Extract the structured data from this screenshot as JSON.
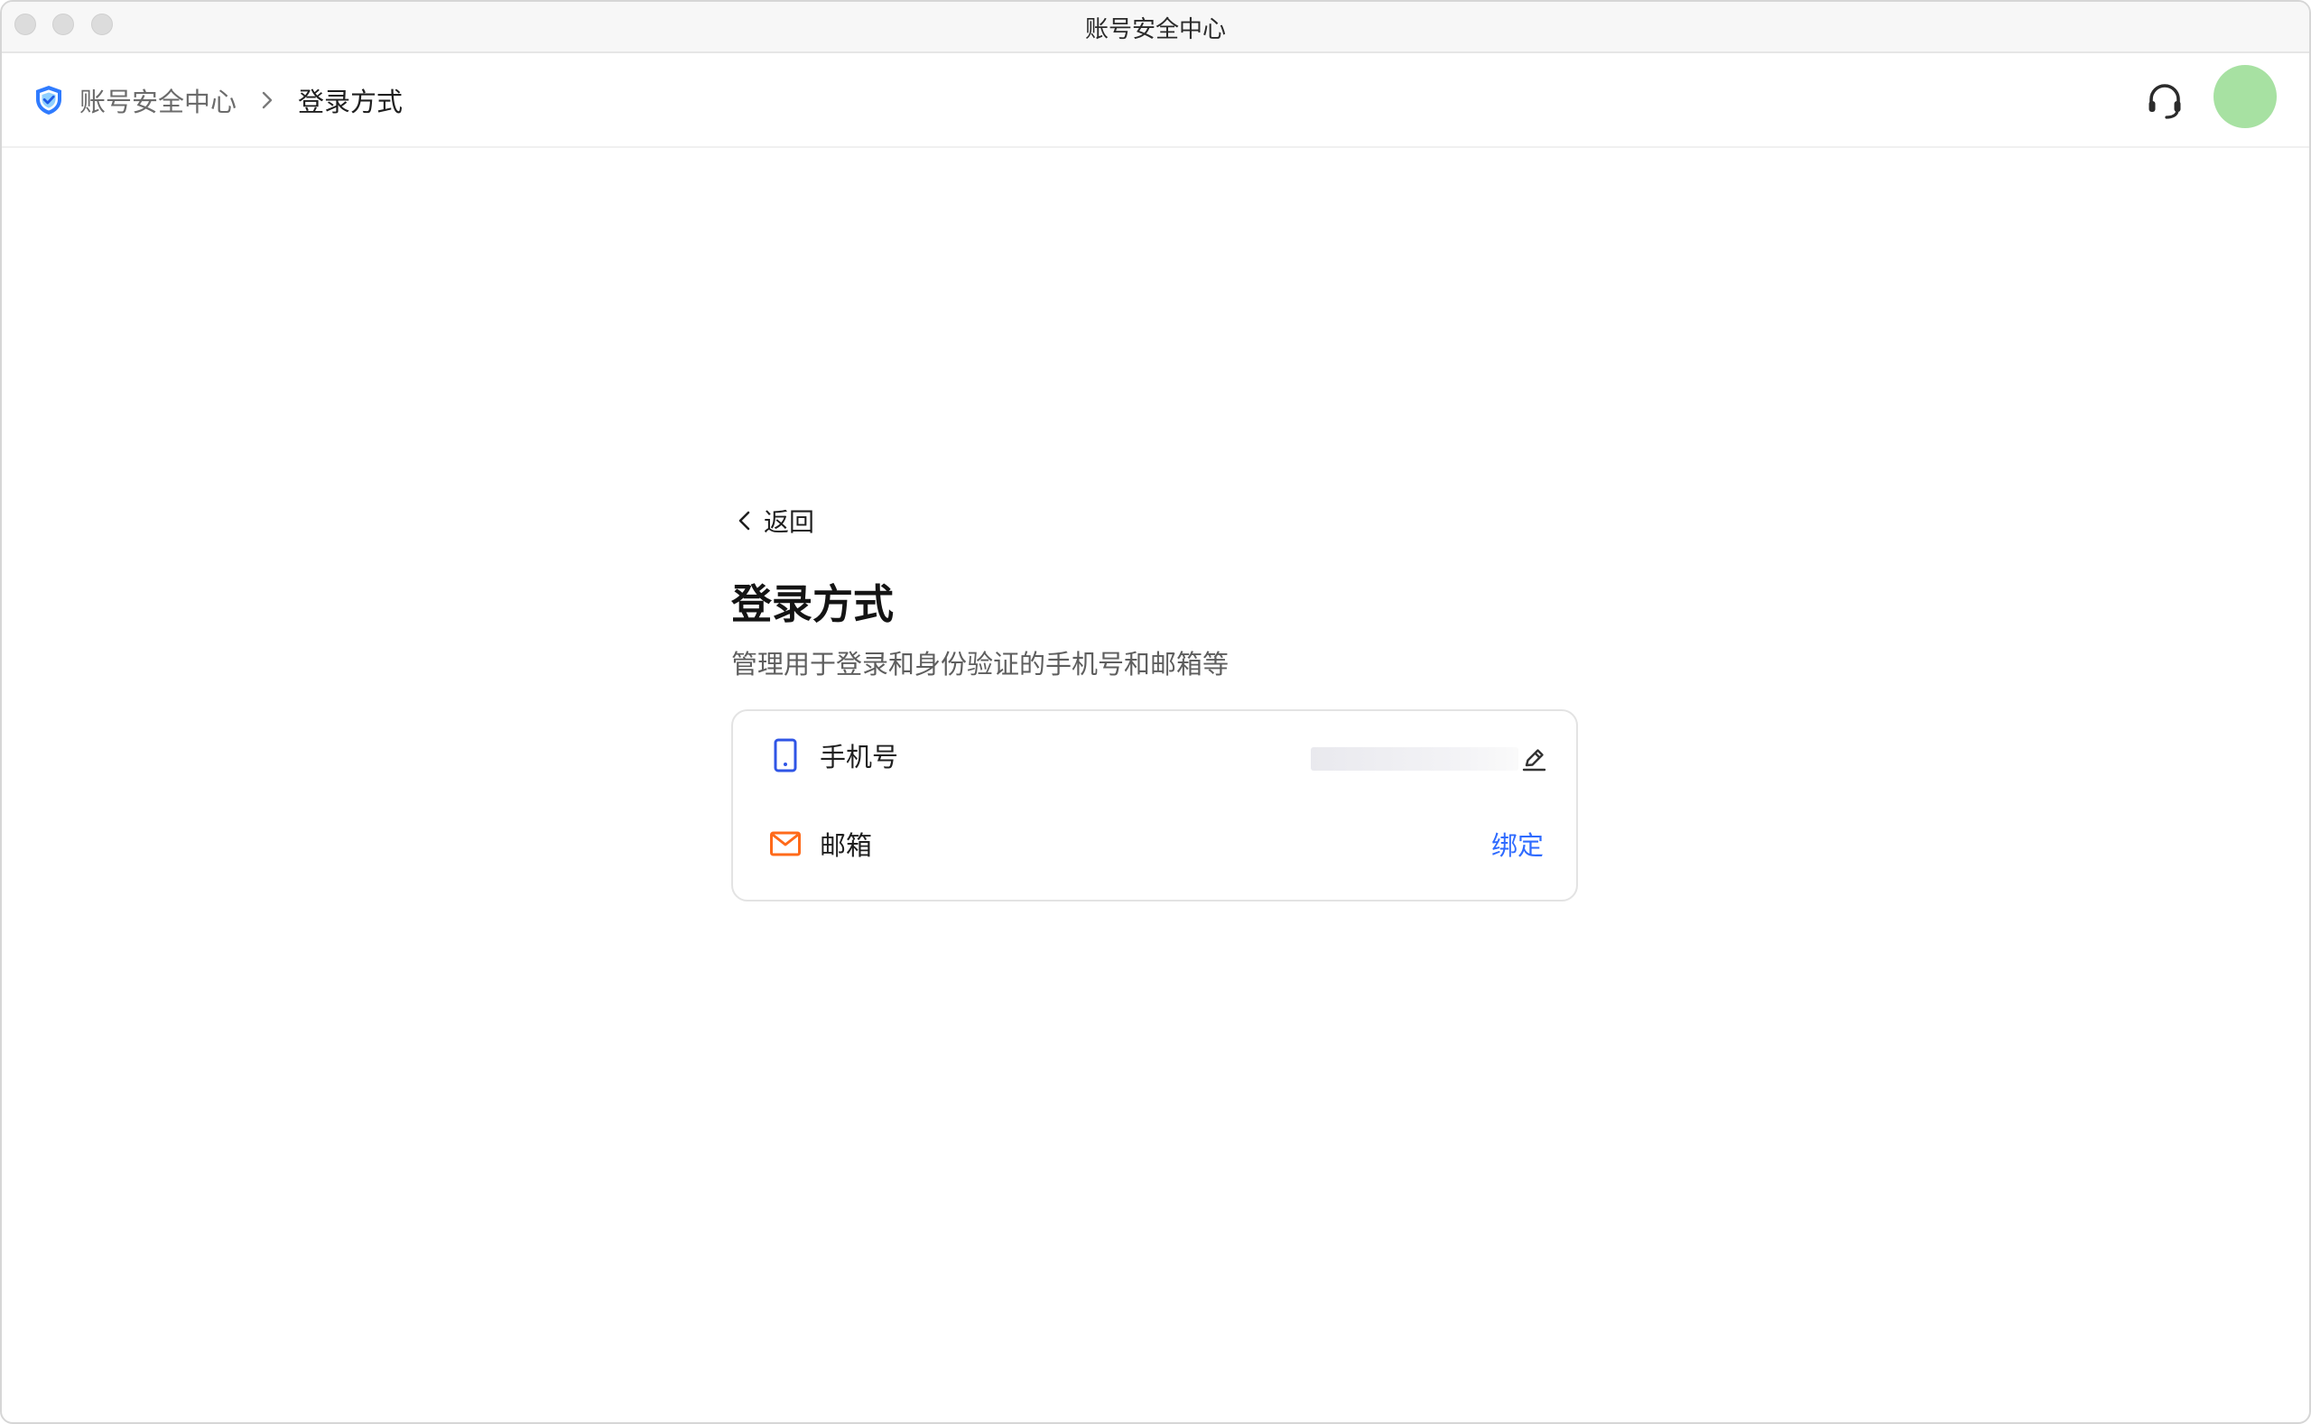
{
  "window": {
    "title": "账号安全中心"
  },
  "header": {
    "breadcrumb": {
      "root_label": "账号安全中心",
      "current_label": "登录方式"
    },
    "icons": {
      "root": "shield-icon",
      "separator": "chevron-right-icon",
      "support": "headset-icon"
    }
  },
  "main": {
    "back_label": "返回",
    "title": "登录方式",
    "subtitle": "管理用于登录和身份验证的手机号和邮箱等",
    "methods": [
      {
        "label": "手机号",
        "icon": "phone-icon",
        "action_icon": "edit-icon"
      },
      {
        "label": "邮箱",
        "icon": "mail-icon",
        "action_label": "绑定"
      }
    ]
  },
  "colors": {
    "accent": "#2f6bff",
    "phone_icon": "#2f55e6",
    "mail_icon": "#ff6a1a",
    "avatar": "#a7e1a2",
    "shield": "#2f7bff"
  }
}
